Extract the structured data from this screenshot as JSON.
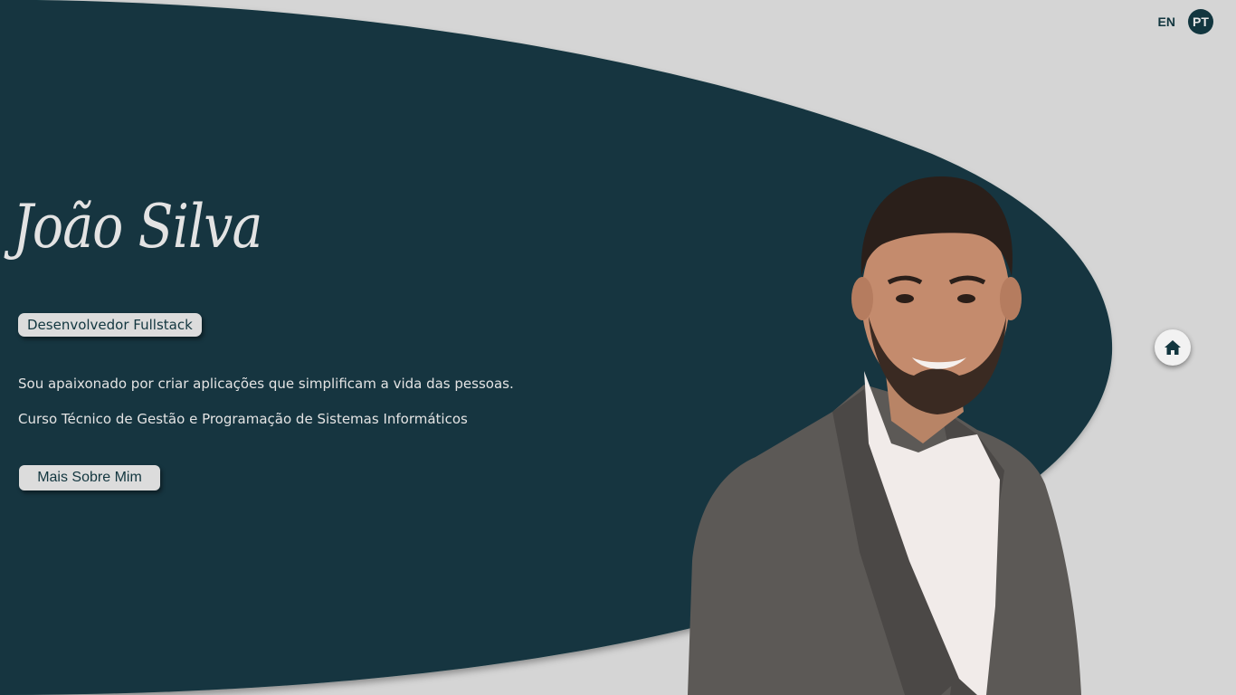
{
  "language": {
    "options": [
      "EN",
      "PT"
    ],
    "active": "PT"
  },
  "hero": {
    "name": "João Silva",
    "role": "Desenvolvedor Fullstack",
    "tagline": "Sou apaixonado por criar aplicações que simplificam a vida das pessoas.",
    "course": "Curso Técnico de Gestão e Programação de Sistemas Informáticos",
    "cta_label": "Mais Sobre Mim"
  },
  "nav": {
    "home_icon": "home-icon"
  },
  "colors": {
    "background": "#d5d5d5",
    "accent": "#12363f",
    "light_text": "#e4e4e4",
    "button_bg": "#dcdcdc"
  }
}
